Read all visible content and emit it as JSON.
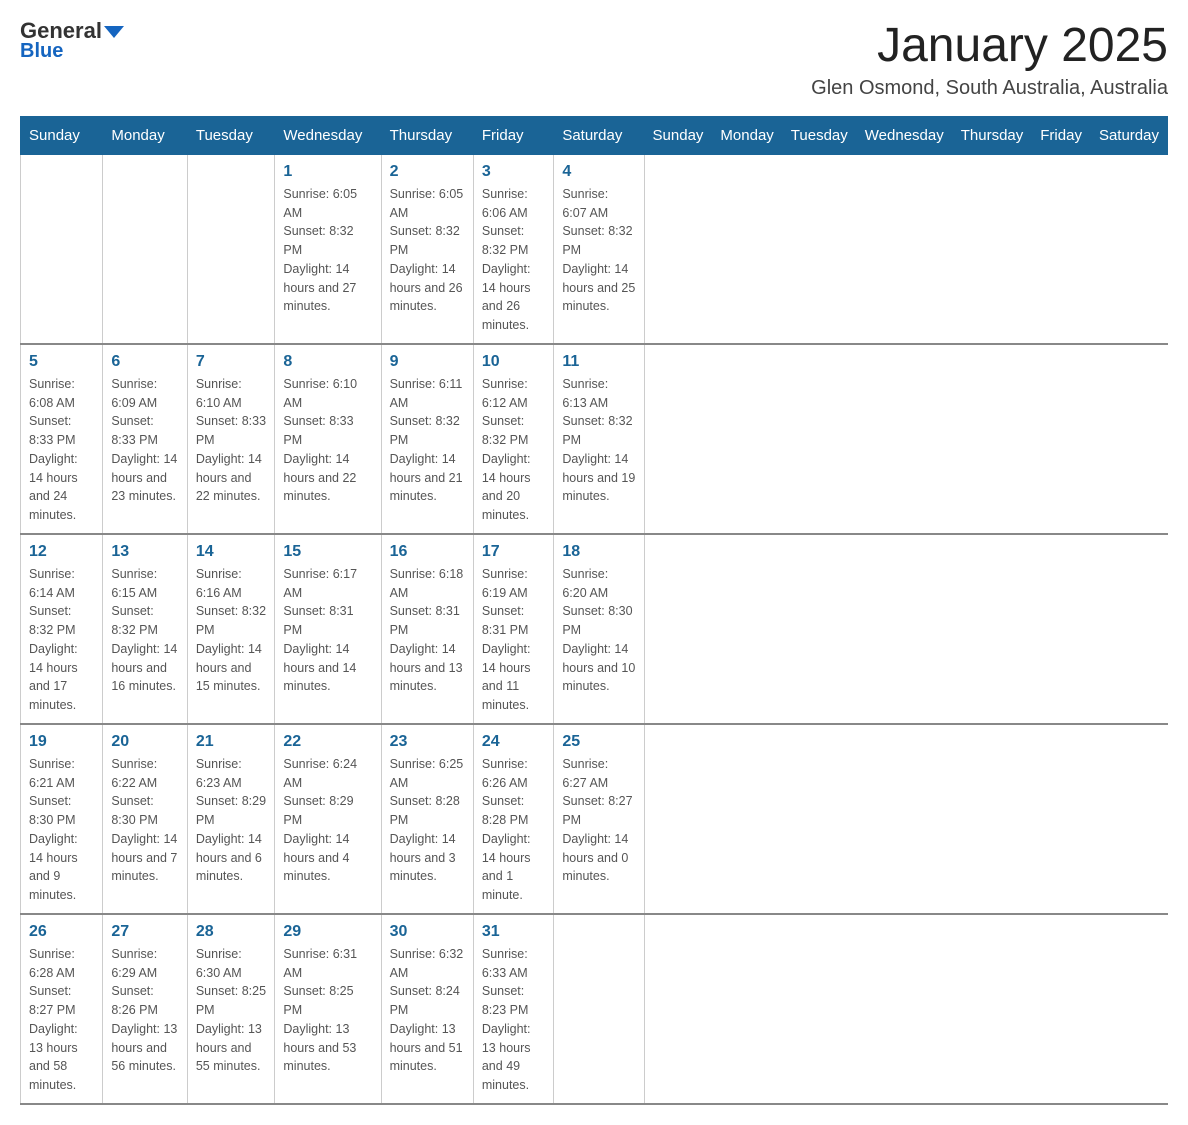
{
  "header": {
    "logo_general": "General",
    "logo_blue": "Blue",
    "month_title": "January 2025",
    "location": "Glen Osmond, South Australia, Australia"
  },
  "days_of_week": [
    "Sunday",
    "Monday",
    "Tuesday",
    "Wednesday",
    "Thursday",
    "Friday",
    "Saturday"
  ],
  "weeks": [
    [
      {
        "day": "",
        "info": ""
      },
      {
        "day": "",
        "info": ""
      },
      {
        "day": "",
        "info": ""
      },
      {
        "day": "1",
        "info": "Sunrise: 6:05 AM\nSunset: 8:32 PM\nDaylight: 14 hours and 27 minutes."
      },
      {
        "day": "2",
        "info": "Sunrise: 6:05 AM\nSunset: 8:32 PM\nDaylight: 14 hours and 26 minutes."
      },
      {
        "day": "3",
        "info": "Sunrise: 6:06 AM\nSunset: 8:32 PM\nDaylight: 14 hours and 26 minutes."
      },
      {
        "day": "4",
        "info": "Sunrise: 6:07 AM\nSunset: 8:32 PM\nDaylight: 14 hours and 25 minutes."
      }
    ],
    [
      {
        "day": "5",
        "info": "Sunrise: 6:08 AM\nSunset: 8:33 PM\nDaylight: 14 hours and 24 minutes."
      },
      {
        "day": "6",
        "info": "Sunrise: 6:09 AM\nSunset: 8:33 PM\nDaylight: 14 hours and 23 minutes."
      },
      {
        "day": "7",
        "info": "Sunrise: 6:10 AM\nSunset: 8:33 PM\nDaylight: 14 hours and 22 minutes."
      },
      {
        "day": "8",
        "info": "Sunrise: 6:10 AM\nSunset: 8:33 PM\nDaylight: 14 hours and 22 minutes."
      },
      {
        "day": "9",
        "info": "Sunrise: 6:11 AM\nSunset: 8:32 PM\nDaylight: 14 hours and 21 minutes."
      },
      {
        "day": "10",
        "info": "Sunrise: 6:12 AM\nSunset: 8:32 PM\nDaylight: 14 hours and 20 minutes."
      },
      {
        "day": "11",
        "info": "Sunrise: 6:13 AM\nSunset: 8:32 PM\nDaylight: 14 hours and 19 minutes."
      }
    ],
    [
      {
        "day": "12",
        "info": "Sunrise: 6:14 AM\nSunset: 8:32 PM\nDaylight: 14 hours and 17 minutes."
      },
      {
        "day": "13",
        "info": "Sunrise: 6:15 AM\nSunset: 8:32 PM\nDaylight: 14 hours and 16 minutes."
      },
      {
        "day": "14",
        "info": "Sunrise: 6:16 AM\nSunset: 8:32 PM\nDaylight: 14 hours and 15 minutes."
      },
      {
        "day": "15",
        "info": "Sunrise: 6:17 AM\nSunset: 8:31 PM\nDaylight: 14 hours and 14 minutes."
      },
      {
        "day": "16",
        "info": "Sunrise: 6:18 AM\nSunset: 8:31 PM\nDaylight: 14 hours and 13 minutes."
      },
      {
        "day": "17",
        "info": "Sunrise: 6:19 AM\nSunset: 8:31 PM\nDaylight: 14 hours and 11 minutes."
      },
      {
        "day": "18",
        "info": "Sunrise: 6:20 AM\nSunset: 8:30 PM\nDaylight: 14 hours and 10 minutes."
      }
    ],
    [
      {
        "day": "19",
        "info": "Sunrise: 6:21 AM\nSunset: 8:30 PM\nDaylight: 14 hours and 9 minutes."
      },
      {
        "day": "20",
        "info": "Sunrise: 6:22 AM\nSunset: 8:30 PM\nDaylight: 14 hours and 7 minutes."
      },
      {
        "day": "21",
        "info": "Sunrise: 6:23 AM\nSunset: 8:29 PM\nDaylight: 14 hours and 6 minutes."
      },
      {
        "day": "22",
        "info": "Sunrise: 6:24 AM\nSunset: 8:29 PM\nDaylight: 14 hours and 4 minutes."
      },
      {
        "day": "23",
        "info": "Sunrise: 6:25 AM\nSunset: 8:28 PM\nDaylight: 14 hours and 3 minutes."
      },
      {
        "day": "24",
        "info": "Sunrise: 6:26 AM\nSunset: 8:28 PM\nDaylight: 14 hours and 1 minute."
      },
      {
        "day": "25",
        "info": "Sunrise: 6:27 AM\nSunset: 8:27 PM\nDaylight: 14 hours and 0 minutes."
      }
    ],
    [
      {
        "day": "26",
        "info": "Sunrise: 6:28 AM\nSunset: 8:27 PM\nDaylight: 13 hours and 58 minutes."
      },
      {
        "day": "27",
        "info": "Sunrise: 6:29 AM\nSunset: 8:26 PM\nDaylight: 13 hours and 56 minutes."
      },
      {
        "day": "28",
        "info": "Sunrise: 6:30 AM\nSunset: 8:25 PM\nDaylight: 13 hours and 55 minutes."
      },
      {
        "day": "29",
        "info": "Sunrise: 6:31 AM\nSunset: 8:25 PM\nDaylight: 13 hours and 53 minutes."
      },
      {
        "day": "30",
        "info": "Sunrise: 6:32 AM\nSunset: 8:24 PM\nDaylight: 13 hours and 51 minutes."
      },
      {
        "day": "31",
        "info": "Sunrise: 6:33 AM\nSunset: 8:23 PM\nDaylight: 13 hours and 49 minutes."
      },
      {
        "day": "",
        "info": ""
      }
    ]
  ]
}
